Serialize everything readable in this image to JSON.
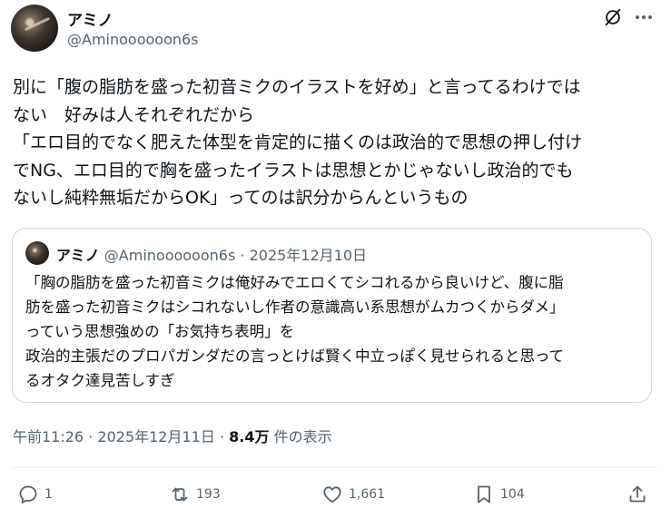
{
  "author": {
    "name": "アミノ",
    "handle": "@Aminoooooon6s"
  },
  "tweet": {
    "lines": [
      "別に「腹の脂肪を盛った初音ミクのイラストを好め」と言ってるわけでは",
      "ない　好みは人それぞれだから",
      "「エロ目的でなく肥えた体型を肯定的に描くのは政治的で思想の押し付け",
      "でNG、エロ目的で胸を盛ったイラストは思想とかじゃないし政治的でも",
      "ないし純粋無垢だからOK」ってのは訳分からんというもの"
    ]
  },
  "quote": {
    "name": "アミノ",
    "handle": "@Aminoooooon6s",
    "separator": "·",
    "date": "2025年12月10日",
    "lines": [
      "「胸の脂肪を盛った初音ミクは俺好みでエロくてシコれるから良いけど、腹に脂",
      "肪を盛った初音ミクはシコれないし作者の意識高い系思想がムカつくからダメ」",
      "っていう思想強めの「お気持ち表明」を",
      "政治的主張だのプロパガンダだの言っとけば賢く中立っぽく見せられると思って",
      "るオタク達見苦しすぎ"
    ]
  },
  "meta": {
    "time": "午前11:26",
    "separator": "·",
    "date": "2025年12月11日",
    "views": "8.4万",
    "views_label": "件の表示"
  },
  "actions": {
    "replies": "1",
    "reposts": "193",
    "likes": "1,661",
    "bookmarks": "104"
  },
  "icons": {
    "grok": "grok-icon",
    "more": "more-icon",
    "reply": "reply-icon",
    "repost": "repost-icon",
    "like": "heart-icon",
    "bookmark": "bookmark-icon",
    "share": "share-icon"
  },
  "colors": {
    "text": "#0f1419",
    "secondary": "#536471",
    "border": "#cfd9de"
  }
}
